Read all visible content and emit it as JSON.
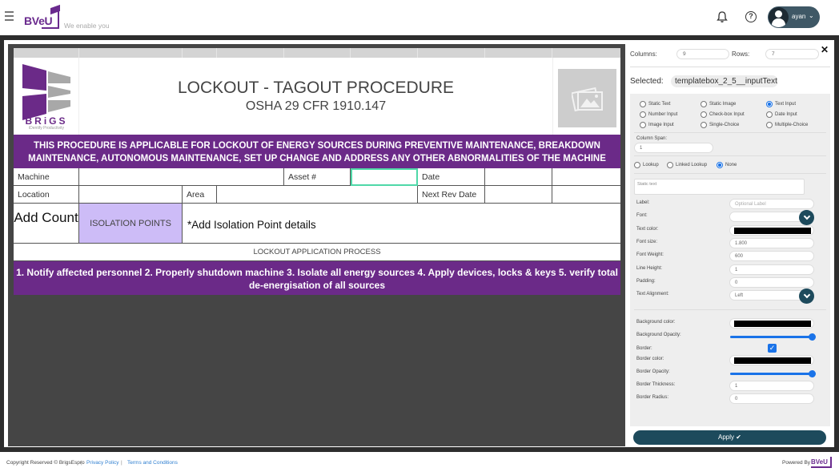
{
  "header": {
    "brand": "BVeU",
    "tagline": "We enable you",
    "user_name": "ayan",
    "icons": {
      "menu": "hamburger-icon",
      "notifications": "bell-icon",
      "help": "question-circle-icon",
      "user": "user-avatar-icon",
      "user_menu": "chevron-down-icon"
    }
  },
  "document": {
    "logo": {
      "name": "BRiGS",
      "tagline": "iDentify Productivity"
    },
    "title": "LOCKOUT - TAGOUT PROCEDURE",
    "subtitle": "OSHA 29 CFR 1910.147",
    "image_placeholder_icon": "image-icon",
    "banner": "THIS PROCEDURE IS APPLICABLE FOR LOCKOUT OF ENERGY SOURCES DURING PREVENTIVE MAINTENANCE, BREAKDOWN MAINTENANCE, AUTONOMOUS MAINTENANCE, SET UP CHANGE AND ADDRESS ANY OTHER ABNORMALITIES OF THE MACHINE",
    "row1": {
      "machine": "Machine",
      "asset": "Asset #",
      "date": "Date"
    },
    "row2": {
      "location": "Location",
      "area": "Area",
      "next_rev_date": "Next Rev Date"
    },
    "row3": {
      "add_count": "Add Count",
      "isolation_points": "ISOLATION POINTS",
      "isolation_details": "*Add Isolation Point details"
    },
    "process_header": "LOCKOUT APPLICATION PROCESS",
    "process_steps": "1. Notify affected personnel    2. Properly shutdown machine    3. Isolate all energy sources    4. Apply devices, locks & keys    5. verify total de-energisation of all sources"
  },
  "panel": {
    "columns_label": "Columns:",
    "columns_value": "9",
    "rows_label": "Rows:",
    "rows_value": "7",
    "selected_label": "Selected:",
    "selected_value": "templatebox_2_5__inputText",
    "types": [
      {
        "label": "Static Text",
        "checked": false
      },
      {
        "label": "Static Image",
        "checked": false
      },
      {
        "label": "Text Input",
        "checked": true
      },
      {
        "label": "Number Input",
        "checked": false
      },
      {
        "label": "Check-box Input",
        "checked": false
      },
      {
        "label": "Date Input",
        "checked": false
      },
      {
        "label": "Image Input",
        "checked": false
      },
      {
        "label": "Single-Choice",
        "checked": false
      },
      {
        "label": "Multiple-Choice",
        "checked": false
      }
    ],
    "column_span_label": "Column Span:",
    "column_span_value": "1",
    "lookup_options": [
      {
        "label": "Lookup",
        "checked": false
      },
      {
        "label": "Linked Lookup",
        "checked": false
      },
      {
        "label": "None",
        "checked": true
      }
    ],
    "static_text_placeholder": "Static text",
    "label_label": "Label:",
    "label_placeholder": "Optional Label",
    "font_label": "Font:",
    "font_value": "",
    "text_color_label": "Text color:",
    "text_color": "#000000",
    "font_size_label": "Font size:",
    "font_size_value": "1.800",
    "font_weight_label": "Font Weight:",
    "font_weight_value": "600",
    "line_height_label": "Line Height:",
    "line_height_value": "1",
    "padding_label": "Padding:",
    "padding_value": "0",
    "text_alignment_label": "Text Alignment:",
    "text_alignment_value": "Left",
    "bg_color_label": "Background color:",
    "bg_color": "#000000",
    "bg_opacity_label": "Background Opacity:",
    "bg_opacity": 1.0,
    "border_label": "Border:",
    "border_checked": true,
    "border_color_label": "Border color:",
    "border_color": "#000000",
    "border_opacity_label": "Border Opacity:",
    "border_opacity": 1.0,
    "border_thickness_label": "Border Thickness:",
    "border_thickness_value": "1",
    "border_radius_label": "Border Radius:",
    "border_radius_value": "0",
    "apply_label": "Apply",
    "close_icon": "close-icon"
  },
  "footer": {
    "copyright": "Copyright Reserved © BrigsEspro",
    "privacy": "Privacy Policy",
    "terms": "Terms and Conditions",
    "powered_by": "Powered By",
    "powered_brand": "BVeU"
  },
  "colors": {
    "accent_purple": "#6b2a88",
    "isolation_fill": "#cdbcf7",
    "panel_button": "#1d4a5c",
    "selection_outline": "#4fd8a8"
  }
}
